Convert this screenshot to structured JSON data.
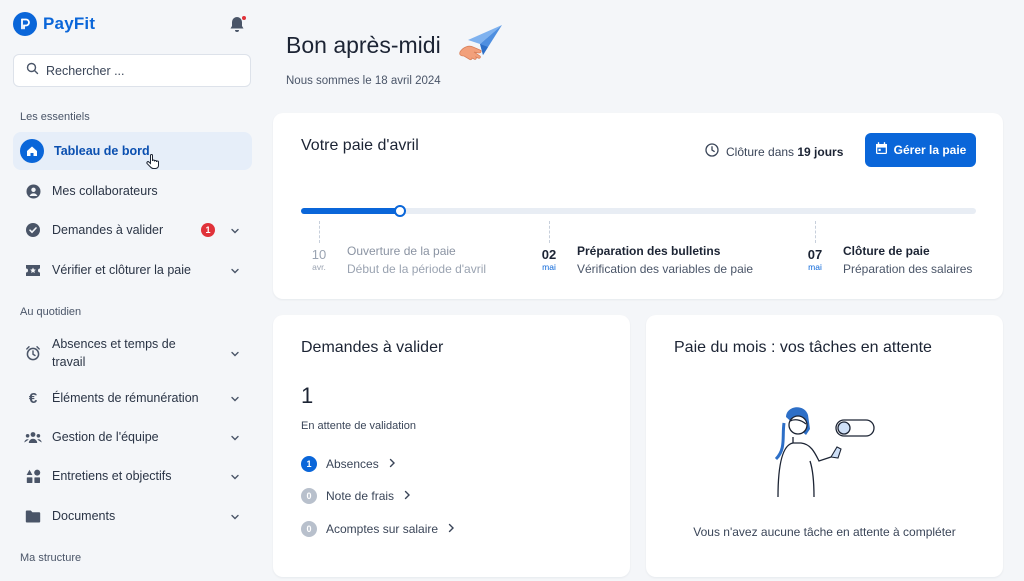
{
  "app": {
    "name": "PayFit"
  },
  "search": {
    "placeholder": "Rechercher ..."
  },
  "sidebar": {
    "sections": [
      "Les essentiels",
      "Au quotidien",
      "Ma structure"
    ],
    "items": [
      {
        "label": "Tableau de bord",
        "icon": "home-icon"
      },
      {
        "label": "Mes collaborateurs",
        "icon": "user-icon"
      },
      {
        "label": "Demandes à valider",
        "icon": "check-badge-icon",
        "badge": "1"
      },
      {
        "label": "Vérifier et clôturer la paie",
        "icon": "ticket-icon"
      },
      {
        "label": "Absences et temps de travail",
        "icon": "alarm-icon"
      },
      {
        "label": "Éléments de rémunération",
        "icon": "euro-icon"
      },
      {
        "label": "Gestion de l'équipe",
        "icon": "team-icon"
      },
      {
        "label": "Entretiens et objectifs",
        "icon": "shapes-icon"
      },
      {
        "label": "Documents",
        "icon": "folder-icon"
      }
    ]
  },
  "header": {
    "greeting": "Bon après-midi",
    "date_line": "Nous sommes le 18 avril 2024"
  },
  "pay_card": {
    "title": "Votre paie d'avril",
    "closing_prefix": "Clôture dans ",
    "closing_days": "19 jours",
    "manage_button": "Gérer la paie",
    "progress_fraction": 0.146,
    "steps": [
      {
        "day": "10",
        "month": "avr.",
        "title": "Ouverture de la paie",
        "sub": "Début de la période d'avril",
        "state": "past"
      },
      {
        "day": "02",
        "month": "mai",
        "title": "Préparation des bulletins",
        "sub": "Vérification des variables de paie",
        "state": "upcoming"
      },
      {
        "day": "07",
        "month": "mai",
        "title": "Clôture de paie",
        "sub": "Préparation des salaires",
        "state": "upcoming"
      }
    ]
  },
  "requests_card": {
    "title": "Demandes à valider",
    "count": "1",
    "count_label": "En attente de validation",
    "items": [
      {
        "count": "1",
        "label": "Absences"
      },
      {
        "count": "0",
        "label": "Note de frais"
      },
      {
        "count": "0",
        "label": "Acomptes sur salaire"
      }
    ]
  },
  "tasks_card": {
    "title": "Paie du mois : vos tâches en attente",
    "empty_text": "Vous n'avez aucune tâche en attente à compléter"
  },
  "colors": {
    "accent": "#0a66d9",
    "alert": "#e0323a",
    "background": "#f4f6f9"
  }
}
